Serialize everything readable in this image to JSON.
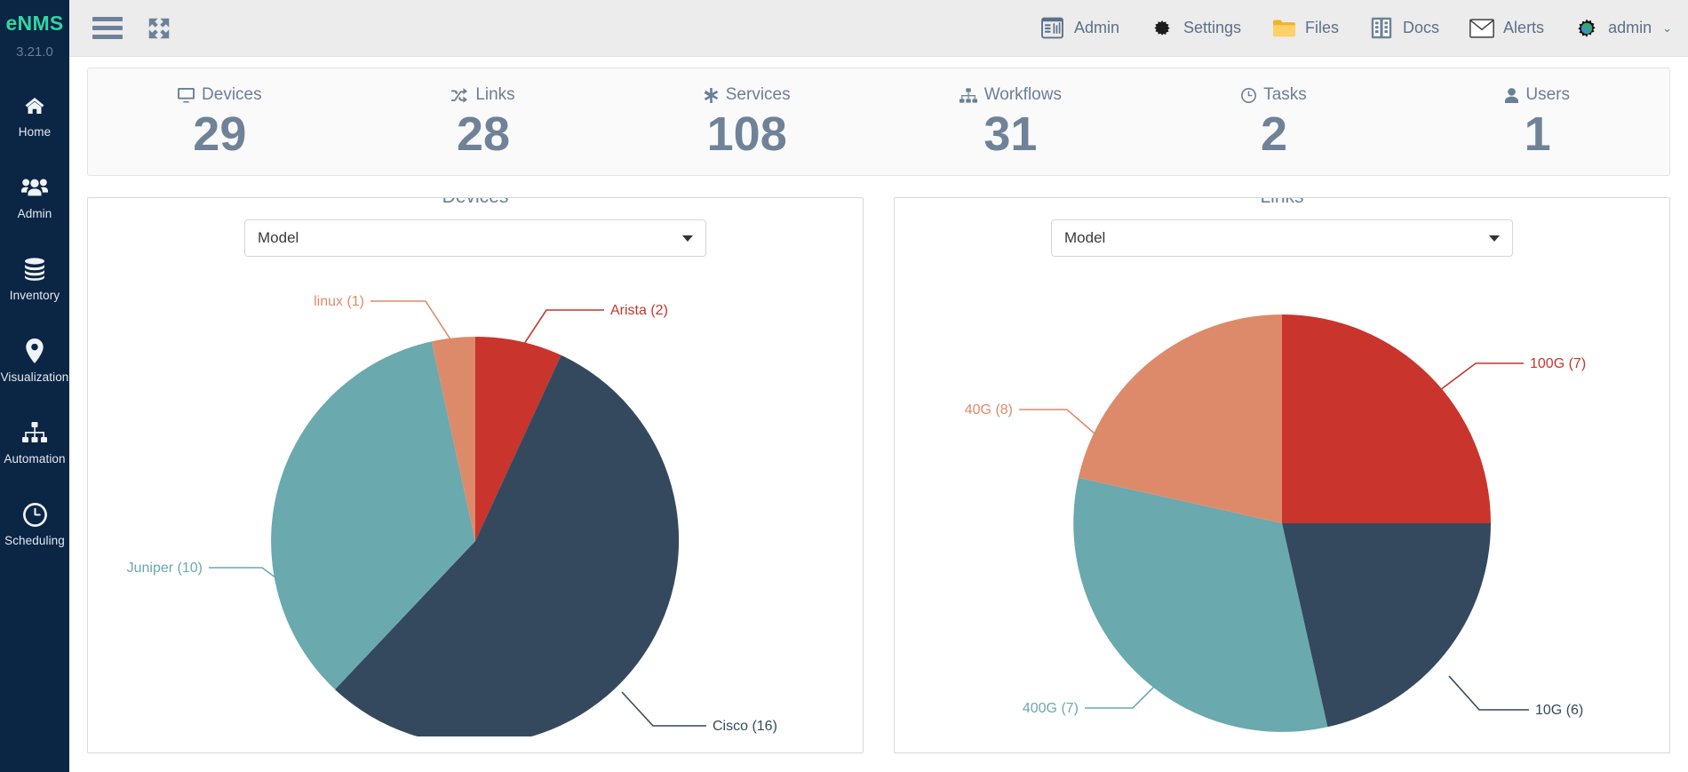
{
  "sidebar": {
    "brand": "eNMS",
    "version": "3.21.0",
    "items": [
      {
        "label": "Home",
        "icon": "home-icon"
      },
      {
        "label": "Admin",
        "icon": "users-icon"
      },
      {
        "label": "Inventory",
        "icon": "database-icon"
      },
      {
        "label": "Visualization",
        "icon": "map-marker-icon"
      },
      {
        "label": "Automation",
        "icon": "sitemap-icon"
      },
      {
        "label": "Scheduling",
        "icon": "clock-icon"
      }
    ]
  },
  "topbar": {
    "menu_icon": "hamburger-icon",
    "expand_icon": "expand-arrows-icon",
    "actions": [
      {
        "label": "Admin",
        "icon": "admin-panel-icon"
      },
      {
        "label": "Settings",
        "icon": "gear-globe-icon"
      },
      {
        "label": "Files",
        "icon": "folder-icon"
      },
      {
        "label": "Docs",
        "icon": "book-icon"
      },
      {
        "label": "Alerts",
        "icon": "envelope-icon"
      }
    ],
    "user": {
      "label": "admin",
      "icon": "user-gear-icon",
      "caret": "⌄"
    }
  },
  "stats": [
    {
      "label": "Devices",
      "value": "29",
      "icon": "desktop-icon"
    },
    {
      "label": "Links",
      "value": "28",
      "icon": "shuffle-icon"
    },
    {
      "label": "Services",
      "value": "108",
      "icon": "asterisk-icon"
    },
    {
      "label": "Workflows",
      "value": "31",
      "icon": "sitemap-icon"
    },
    {
      "label": "Tasks",
      "value": "2",
      "icon": "clock-icon"
    },
    {
      "label": "Users",
      "value": "1",
      "icon": "user-icon"
    }
  ],
  "panels": {
    "devices": {
      "title": "Devices",
      "select_value": "Model"
    },
    "links": {
      "title": "Links",
      "select_value": "Model"
    }
  },
  "colors": {
    "brand_green": "#2fd6a0",
    "sidebar_bg": "#0b2545",
    "topbar_bg": "#ececec",
    "muted_blue": "#6a7f98",
    "slate": "#34495e",
    "teal": "#6aa9ae",
    "red": "#c9342c",
    "salmon": "#dd8a6a"
  },
  "chart_data": [
    {
      "type": "pie",
      "title": "Devices",
      "group_by": "Model",
      "total": 29,
      "categories": [
        "Arista",
        "Cisco",
        "Juniper",
        "linux"
      ],
      "values": [
        2,
        16,
        10,
        1
      ],
      "labels": [
        "Arista (2)",
        "Cisco (16)",
        "Juniper (10)",
        "linux (1)"
      ],
      "colors": [
        "#c9342c",
        "#34495e",
        "#6aa9ae",
        "#dd8a6a"
      ],
      "legend": "outside-labels-with-leader-lines",
      "grid": false
    },
    {
      "type": "pie",
      "title": "Links",
      "group_by": "Model",
      "total": 28,
      "categories": [
        "100G",
        "10G",
        "400G",
        "40G"
      ],
      "values": [
        7,
        6,
        7,
        8
      ],
      "labels": [
        "100G (7)",
        "10G (6)",
        "400G (7)",
        "40G (8)"
      ],
      "colors": [
        "#c9342c",
        "#34495e",
        "#6aa9ae",
        "#dd8a6a"
      ],
      "legend": "outside-labels-with-leader-lines",
      "grid": false
    }
  ]
}
